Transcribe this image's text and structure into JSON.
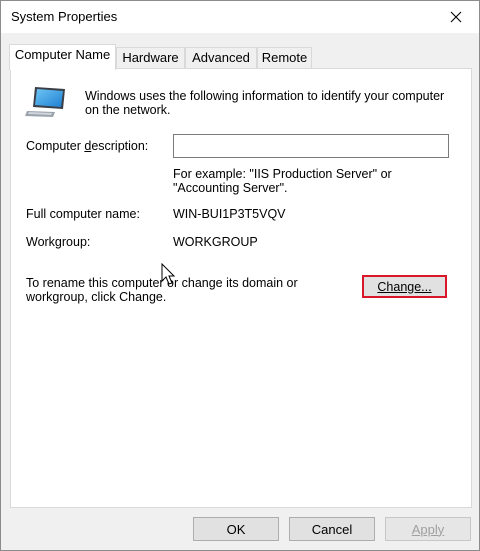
{
  "window": {
    "title": "System Properties"
  },
  "tabs": [
    {
      "label": "Computer Name",
      "active": true
    },
    {
      "label": "Hardware",
      "active": false
    },
    {
      "label": "Advanced",
      "active": false
    },
    {
      "label": "Remote",
      "active": false
    }
  ],
  "panel": {
    "intro_line1": "Windows uses the following information to identify your computer",
    "intro_line2": "on the network.",
    "description_label": "Computer description:",
    "description_value": "",
    "example_line1": "For example: \"IIS Production Server\" or",
    "example_line2": "\"Accounting Server\".",
    "full_name_label": "Full computer name:",
    "full_name_value": "WIN-BUI1P3T5VQV",
    "workgroup_label": "Workgroup:",
    "workgroup_value": "WORKGROUP",
    "rename_line1": "To rename this computer or change its domain or",
    "rename_line2": "workgroup, click Change.",
    "change_button": "Change..."
  },
  "footer": {
    "ok": "OK",
    "cancel": "Cancel",
    "apply": "Apply",
    "apply_enabled": false
  },
  "colors": {
    "highlight": "#d9162a",
    "panel_bg": "#ffffff",
    "dialog_bg": "#f0f0f0"
  },
  "icons": {
    "computer": "computer-monitor-icon",
    "close": "close-icon",
    "cursor": "mouse-pointer-icon"
  }
}
